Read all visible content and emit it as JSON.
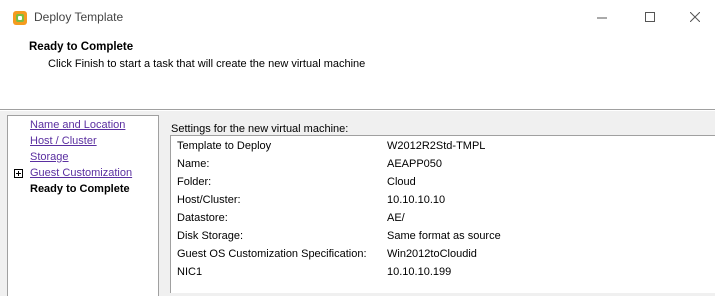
{
  "window": {
    "title": "Deploy Template"
  },
  "header": {
    "title": "Ready to Complete",
    "subtitle": "Click Finish to start a task that will create the new virtual machine"
  },
  "nav": {
    "items": [
      {
        "label": "Name and Location",
        "state": "link"
      },
      {
        "label": "Host / Cluster",
        "state": "link"
      },
      {
        "label": "Storage",
        "state": "link"
      },
      {
        "label": "Guest Customization",
        "state": "link",
        "expandable": true
      },
      {
        "label": "Ready to Complete",
        "state": "current"
      }
    ]
  },
  "settings": {
    "label": "Settings for the new virtual machine:",
    "rows": [
      {
        "key": "Template to Deploy",
        "value": "W2012R2Std-TMPL"
      },
      {
        "key": "Name:",
        "value": "AEAPP050"
      },
      {
        "key": "Folder:",
        "value": "Cloud"
      },
      {
        "key": "Host/Cluster:",
        "value": "10.10.10.10"
      },
      {
        "key": "Datastore:",
        "value": "AE/"
      },
      {
        "key": "Disk Storage:",
        "value": "Same format as source"
      },
      {
        "key": "Guest OS Customization Specification:",
        "value": "Win2012toCloudid"
      },
      {
        "key": "NIC1",
        "value": "10.10.10.199"
      }
    ]
  },
  "icons": {
    "app": "vsphere-logo-icon",
    "minimize": "minimize-icon",
    "maximize": "maximize-icon",
    "close": "close-icon",
    "expander": "plus-box-icon"
  },
  "colors": {
    "link": "#5a2fa0",
    "logo_orange": "#f59b1e",
    "logo_green": "#7cbd42"
  }
}
